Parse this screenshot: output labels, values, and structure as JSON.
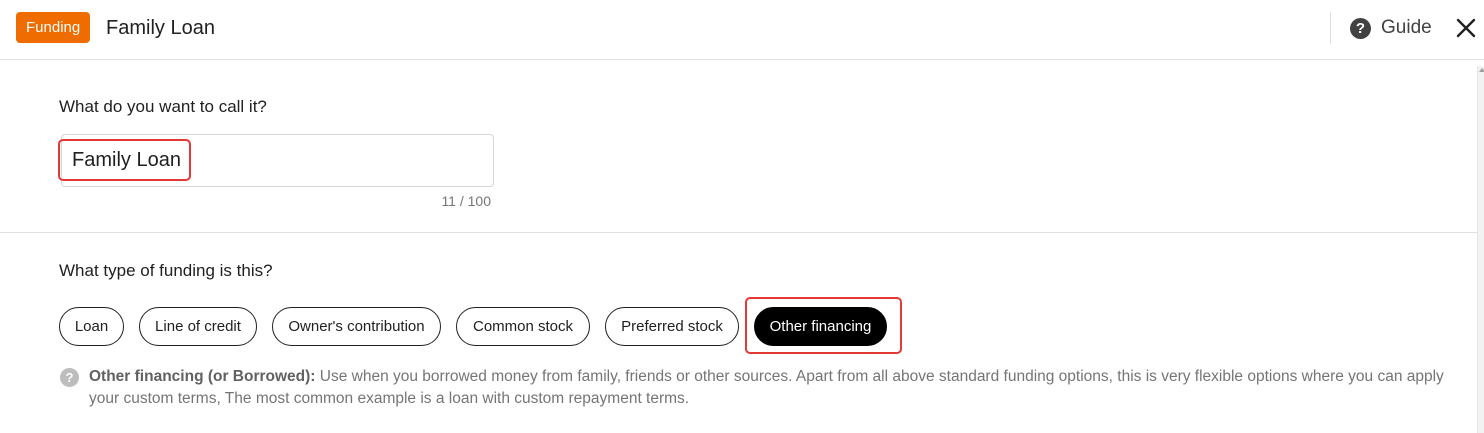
{
  "header": {
    "badge": "Funding",
    "title": "Family Loan",
    "guide_label": "Guide",
    "guide_icon": "help-circle-icon",
    "close_icon": "close-icon"
  },
  "name_section": {
    "question": "What do you want to call it?",
    "value": "Family Loan",
    "counter": "11 / 100"
  },
  "type_section": {
    "question": "What type of funding is this?",
    "options": [
      "Loan",
      "Line of credit",
      "Owner's contribution",
      "Common stock",
      "Preferred stock",
      "Other financing"
    ],
    "selected": "Other financing",
    "help_title": "Other financing (or Borrowed):",
    "help_body": " Use when you borrowed money from family, friends or other sources. Apart from all above standard funding options, this is very flexible options where you can apply your custom terms, The most common example is a loan with custom repayment terms."
  },
  "colors": {
    "badge": "#ef6c00",
    "highlight": "#e53935",
    "selected_chip": "#000000"
  }
}
